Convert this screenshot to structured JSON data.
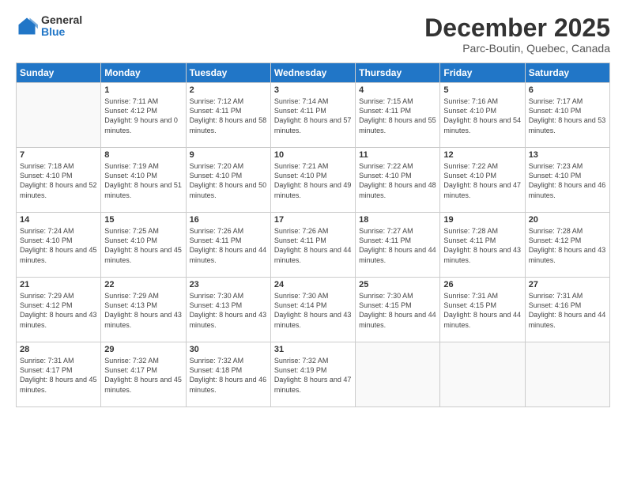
{
  "logo": {
    "general": "General",
    "blue": "Blue"
  },
  "title": "December 2025",
  "subtitle": "Parc-Boutin, Quebec, Canada",
  "headers": [
    "Sunday",
    "Monday",
    "Tuesday",
    "Wednesday",
    "Thursday",
    "Friday",
    "Saturday"
  ],
  "weeks": [
    [
      {
        "day": "",
        "empty": true
      },
      {
        "day": "1",
        "sunrise": "Sunrise: 7:11 AM",
        "sunset": "Sunset: 4:12 PM",
        "daylight": "Daylight: 9 hours and 0 minutes."
      },
      {
        "day": "2",
        "sunrise": "Sunrise: 7:12 AM",
        "sunset": "Sunset: 4:11 PM",
        "daylight": "Daylight: 8 hours and 58 minutes."
      },
      {
        "day": "3",
        "sunrise": "Sunrise: 7:14 AM",
        "sunset": "Sunset: 4:11 PM",
        "daylight": "Daylight: 8 hours and 57 minutes."
      },
      {
        "day": "4",
        "sunrise": "Sunrise: 7:15 AM",
        "sunset": "Sunset: 4:11 PM",
        "daylight": "Daylight: 8 hours and 55 minutes."
      },
      {
        "day": "5",
        "sunrise": "Sunrise: 7:16 AM",
        "sunset": "Sunset: 4:10 PM",
        "daylight": "Daylight: 8 hours and 54 minutes."
      },
      {
        "day": "6",
        "sunrise": "Sunrise: 7:17 AM",
        "sunset": "Sunset: 4:10 PM",
        "daylight": "Daylight: 8 hours and 53 minutes."
      }
    ],
    [
      {
        "day": "7",
        "sunrise": "Sunrise: 7:18 AM",
        "sunset": "Sunset: 4:10 PM",
        "daylight": "Daylight: 8 hours and 52 minutes."
      },
      {
        "day": "8",
        "sunrise": "Sunrise: 7:19 AM",
        "sunset": "Sunset: 4:10 PM",
        "daylight": "Daylight: 8 hours and 51 minutes."
      },
      {
        "day": "9",
        "sunrise": "Sunrise: 7:20 AM",
        "sunset": "Sunset: 4:10 PM",
        "daylight": "Daylight: 8 hours and 50 minutes."
      },
      {
        "day": "10",
        "sunrise": "Sunrise: 7:21 AM",
        "sunset": "Sunset: 4:10 PM",
        "daylight": "Daylight: 8 hours and 49 minutes."
      },
      {
        "day": "11",
        "sunrise": "Sunrise: 7:22 AM",
        "sunset": "Sunset: 4:10 PM",
        "daylight": "Daylight: 8 hours and 48 minutes."
      },
      {
        "day": "12",
        "sunrise": "Sunrise: 7:22 AM",
        "sunset": "Sunset: 4:10 PM",
        "daylight": "Daylight: 8 hours and 47 minutes."
      },
      {
        "day": "13",
        "sunrise": "Sunrise: 7:23 AM",
        "sunset": "Sunset: 4:10 PM",
        "daylight": "Daylight: 8 hours and 46 minutes."
      }
    ],
    [
      {
        "day": "14",
        "sunrise": "Sunrise: 7:24 AM",
        "sunset": "Sunset: 4:10 PM",
        "daylight": "Daylight: 8 hours and 45 minutes."
      },
      {
        "day": "15",
        "sunrise": "Sunrise: 7:25 AM",
        "sunset": "Sunset: 4:10 PM",
        "daylight": "Daylight: 8 hours and 45 minutes."
      },
      {
        "day": "16",
        "sunrise": "Sunrise: 7:26 AM",
        "sunset": "Sunset: 4:11 PM",
        "daylight": "Daylight: 8 hours and 44 minutes."
      },
      {
        "day": "17",
        "sunrise": "Sunrise: 7:26 AM",
        "sunset": "Sunset: 4:11 PM",
        "daylight": "Daylight: 8 hours and 44 minutes."
      },
      {
        "day": "18",
        "sunrise": "Sunrise: 7:27 AM",
        "sunset": "Sunset: 4:11 PM",
        "daylight": "Daylight: 8 hours and 44 minutes."
      },
      {
        "day": "19",
        "sunrise": "Sunrise: 7:28 AM",
        "sunset": "Sunset: 4:11 PM",
        "daylight": "Daylight: 8 hours and 43 minutes."
      },
      {
        "day": "20",
        "sunrise": "Sunrise: 7:28 AM",
        "sunset": "Sunset: 4:12 PM",
        "daylight": "Daylight: 8 hours and 43 minutes."
      }
    ],
    [
      {
        "day": "21",
        "sunrise": "Sunrise: 7:29 AM",
        "sunset": "Sunset: 4:12 PM",
        "daylight": "Daylight: 8 hours and 43 minutes."
      },
      {
        "day": "22",
        "sunrise": "Sunrise: 7:29 AM",
        "sunset": "Sunset: 4:13 PM",
        "daylight": "Daylight: 8 hours and 43 minutes."
      },
      {
        "day": "23",
        "sunrise": "Sunrise: 7:30 AM",
        "sunset": "Sunset: 4:13 PM",
        "daylight": "Daylight: 8 hours and 43 minutes."
      },
      {
        "day": "24",
        "sunrise": "Sunrise: 7:30 AM",
        "sunset": "Sunset: 4:14 PM",
        "daylight": "Daylight: 8 hours and 43 minutes."
      },
      {
        "day": "25",
        "sunrise": "Sunrise: 7:30 AM",
        "sunset": "Sunset: 4:15 PM",
        "daylight": "Daylight: 8 hours and 44 minutes."
      },
      {
        "day": "26",
        "sunrise": "Sunrise: 7:31 AM",
        "sunset": "Sunset: 4:15 PM",
        "daylight": "Daylight: 8 hours and 44 minutes."
      },
      {
        "day": "27",
        "sunrise": "Sunrise: 7:31 AM",
        "sunset": "Sunset: 4:16 PM",
        "daylight": "Daylight: 8 hours and 44 minutes."
      }
    ],
    [
      {
        "day": "28",
        "sunrise": "Sunrise: 7:31 AM",
        "sunset": "Sunset: 4:17 PM",
        "daylight": "Daylight: 8 hours and 45 minutes."
      },
      {
        "day": "29",
        "sunrise": "Sunrise: 7:32 AM",
        "sunset": "Sunset: 4:17 PM",
        "daylight": "Daylight: 8 hours and 45 minutes."
      },
      {
        "day": "30",
        "sunrise": "Sunrise: 7:32 AM",
        "sunset": "Sunset: 4:18 PM",
        "daylight": "Daylight: 8 hours and 46 minutes."
      },
      {
        "day": "31",
        "sunrise": "Sunrise: 7:32 AM",
        "sunset": "Sunset: 4:19 PM",
        "daylight": "Daylight: 8 hours and 47 minutes."
      },
      {
        "day": "",
        "empty": true
      },
      {
        "day": "",
        "empty": true
      },
      {
        "day": "",
        "empty": true
      }
    ]
  ]
}
